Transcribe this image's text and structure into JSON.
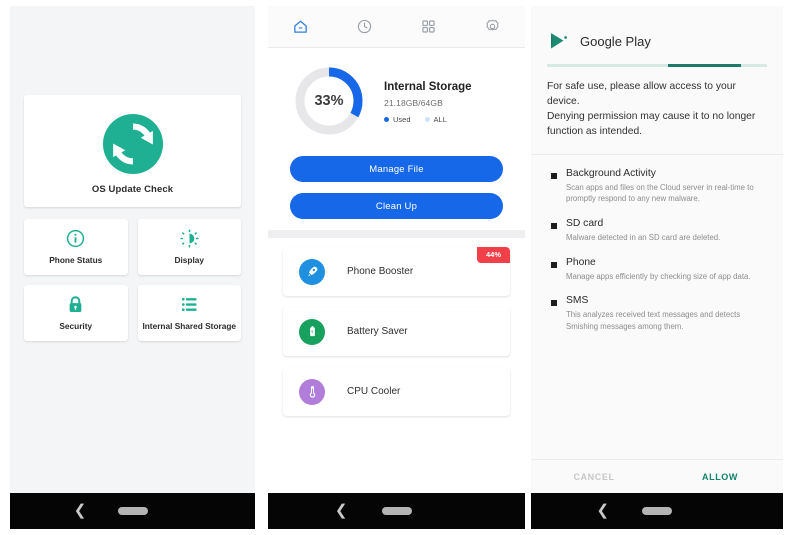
{
  "theme": {
    "teal": "#1fb094",
    "blue": "#1668e8",
    "light_blue": "#cfe2fb",
    "red_badge": "#f2404a",
    "green": "#18a05f",
    "purple": "#b07ddb",
    "gp_teal": "#1d7a68",
    "screen_bg": "#f4f5f6"
  },
  "phone1": {
    "name": "device-care-home",
    "hero": {
      "icon": "refresh-sync-icon",
      "label": "OS Update Check"
    },
    "tiles": [
      {
        "icon": "info-circle-icon",
        "label": "Phone Status"
      },
      {
        "icon": "brightness-icon",
        "label": "Display"
      },
      {
        "icon": "lock-icon",
        "label": "Security"
      },
      {
        "icon": "storage-list-icon",
        "label": "Internal Shared Storage"
      }
    ],
    "navbar": {
      "back": "back-chevron-icon",
      "home": "home-pill-indicator"
    }
  },
  "phone2": {
    "name": "storage-cleaner-home",
    "tabs": [
      {
        "icon": "home-icon",
        "name": "tab-home",
        "active": true
      },
      {
        "icon": "clock-icon",
        "name": "tab-history",
        "active": false
      },
      {
        "icon": "grid-icon",
        "name": "tab-apps",
        "active": false
      },
      {
        "icon": "gear-icon",
        "name": "tab-settings",
        "active": false
      }
    ],
    "storage": {
      "percent_label": "33%",
      "percent_value": 33,
      "title": "Internal Storage",
      "subtitle": "21.18GB/64GB",
      "legend": [
        {
          "label": "Used",
          "color": "#1668e8"
        },
        {
          "label": "ALL",
          "color": "#cfe2fb"
        }
      ]
    },
    "buttons": [
      {
        "label": "Manage File",
        "name": "manage-file-button"
      },
      {
        "label": "Clean Up",
        "name": "clean-up-button"
      }
    ],
    "features": [
      {
        "label": "Phone Booster",
        "icon": "rocket-boost-icon",
        "color": "#1f8fe0",
        "badge": "44%"
      },
      {
        "label": "Battery Saver",
        "icon": "battery-icon",
        "color": "#18a05f",
        "badge": null
      },
      {
        "label": "CPU Cooler",
        "icon": "thermometer-icon",
        "color": "#b07ddb",
        "badge": null
      }
    ],
    "navbar": {
      "back": "back-chevron-icon",
      "home": "home-pill-indicator"
    }
  },
  "phone3": {
    "name": "google-play-permission-dialog",
    "header": {
      "logo": "google-play-icon",
      "title": "Google Play"
    },
    "progress": {
      "start_percent": 55,
      "width_percent": 33
    },
    "intro": "For safe use, please allow access to your device.\nDenying permission may cause it to no longer function as intended.",
    "permissions": [
      {
        "title": "Background Activity",
        "desc": "Scan apps and files on the Cloud server in real-time to promptly respond to any new malware."
      },
      {
        "title": "SD card",
        "desc": "Malware detected in an SD card are deleted."
      },
      {
        "title": "Phone",
        "desc": "Manage apps efficiently by checking size of app data."
      },
      {
        "title": "SMS",
        "desc": "This analyzes received text messages and detects Smishing messages among them."
      }
    ],
    "actions": {
      "cancel": "CANCEL",
      "allow": "ALLOW"
    },
    "navbar": {
      "back": "back-chevron-icon",
      "home": "home-pill-indicator"
    }
  }
}
